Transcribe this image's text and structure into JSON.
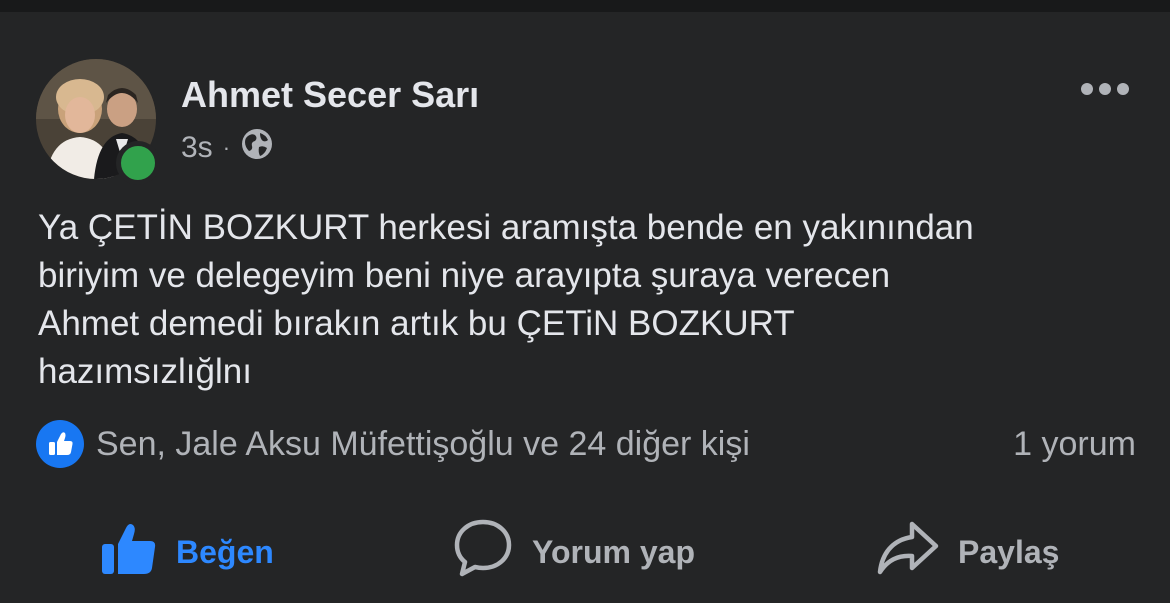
{
  "post": {
    "author": "Ahmet Secer Sarı",
    "timestamp": "3s",
    "separator": "·",
    "privacy_icon": "globe-icon",
    "text": "Ya ÇETİN BOZKURT herkesi aramışta bende en yakınından\nbiriyim ve delegeyim beni niye arayıpta şuraya verecen\nAhmet demedi bırakın artık bu ÇETiN BOZKURT\nhazımsızlığlnı",
    "online": true
  },
  "reactions": {
    "icon": "like-icon",
    "summary": "Sen, Jale Aksu Müfettişoğlu ve 24 diğer kişi",
    "comments": "1 yorum"
  },
  "actions": {
    "like": "Beğen",
    "comment": "Yorum yap",
    "share": "Paylaş"
  },
  "colors": {
    "background": "#242526",
    "primary_text": "#e4e6eb",
    "secondary_text": "#b0b3b8",
    "accent": "#2d88ff",
    "online": "#31a24c"
  }
}
